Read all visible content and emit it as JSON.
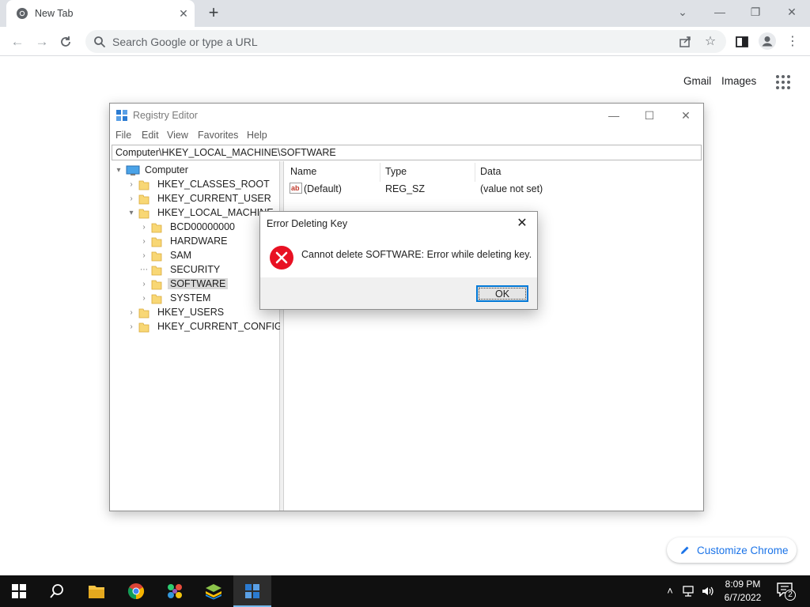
{
  "browser": {
    "tab": {
      "title": "New Tab",
      "close": "✕"
    },
    "new_tab": "+",
    "window_controls": {
      "tab_search": "⌄",
      "minimize": "—",
      "restore": "❐",
      "close": "✕"
    },
    "omnibox": {
      "placeholder": "Search Google or type a URL"
    },
    "ntp": {
      "gmail": "Gmail",
      "images": "Images",
      "customize": "Customize Chrome"
    }
  },
  "regedit": {
    "title": "Registry Editor",
    "menu": [
      "File",
      "Edit",
      "View",
      "Favorites",
      "Help"
    ],
    "address": "Computer\\HKEY_LOCAL_MACHINE\\SOFTWARE",
    "tree": {
      "root": "Computer",
      "nodes": [
        "HKEY_CLASSES_ROOT",
        "HKEY_CURRENT_USER",
        "HKEY_LOCAL_MACHINE",
        "BCD00000000",
        "HARDWARE",
        "SAM",
        "SECURITY",
        "SOFTWARE",
        "SYSTEM",
        "HKEY_USERS",
        "HKEY_CURRENT_CONFIG"
      ],
      "selected": "SOFTWARE"
    },
    "columns": [
      "Name",
      "Type",
      "Data"
    ],
    "values": [
      {
        "name": "(Default)",
        "type": "REG_SZ",
        "data": "(value not set)"
      }
    ]
  },
  "dialog": {
    "title": "Error Deleting Key",
    "message": "Cannot delete SOFTWARE:  Error while deleting key.",
    "ok": "OK"
  },
  "taskbar": {
    "time": "8:09 PM",
    "date": "6/7/2022",
    "notification_count": "2"
  },
  "colors": {
    "accent": "#0078d7",
    "chrome_link": "#1a73e8",
    "error": "#e81123",
    "folder": "#f8d775"
  }
}
